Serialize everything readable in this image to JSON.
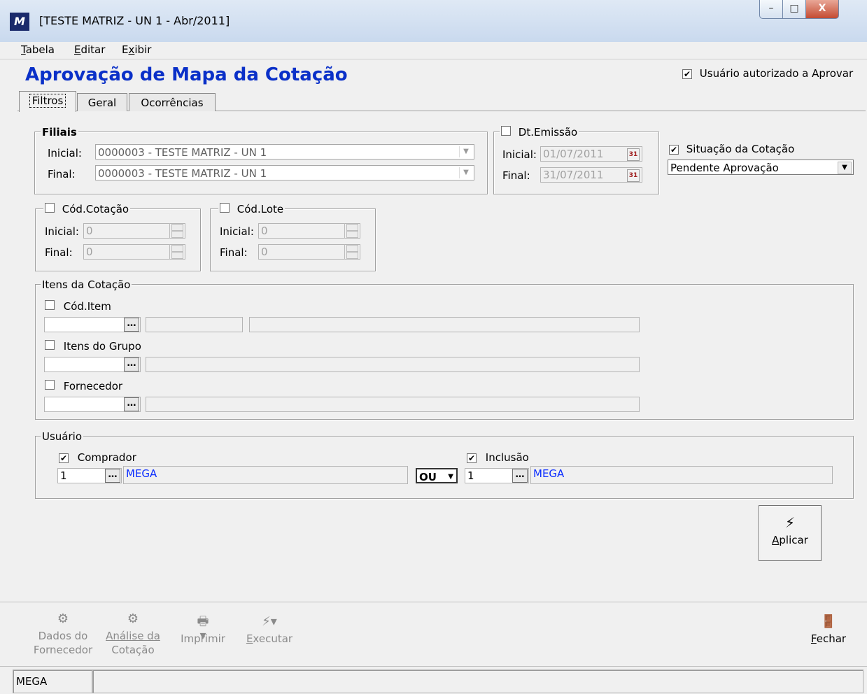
{
  "window": {
    "title": "[TESTE MATRIZ - UN 1 - Abr/2011]",
    "min": "–",
    "max": "□",
    "close": "X"
  },
  "menu": [
    {
      "label_first": "T",
      "label_rest": "abela"
    },
    {
      "label_first": "E",
      "label_rest": "ditar"
    },
    {
      "label_pre": "E",
      "label_u": "x",
      "label_rest": "ibir"
    }
  ],
  "page": {
    "title": "Aprovação de Mapa da Cotação",
    "authorized_label": "Usuário autorizado a Aprovar",
    "authorized_checked": "✔"
  },
  "tabs": {
    "filtros": "Filtros",
    "geral": "Geral",
    "ocorrencias": "Ocorrências"
  },
  "filiais": {
    "label": "Filiais",
    "initial_label": "Inicial:",
    "initial_value": "0000003 - TESTE MATRIZ - UN 1",
    "final_label": "Final:",
    "final_value": "0000003 - TESTE MATRIZ - UN 1"
  },
  "dt_emissao": {
    "label": "Dt.Emissão",
    "initial_label": "Inicial:",
    "initial_value": "01/07/2011",
    "final_label": "Final:",
    "final_value": "31/07/2011"
  },
  "situacao": {
    "label": "Situação da Cotação",
    "checked": "✔",
    "value": "Pendente Aprovação"
  },
  "cod_cotacao": {
    "label": "Cód.Cotação",
    "initial_label": "Inicial:",
    "initial_value": "0",
    "final_label": "Final:",
    "final_value": "0"
  },
  "cod_lote": {
    "label": "Cód.Lote",
    "initial_label": "Inicial:",
    "initial_value": "0",
    "final_label": "Final:",
    "final_value": "0"
  },
  "itens": {
    "label": "Itens da Cotação",
    "cod_item": "Cód.Item",
    "itens_grupo": "Itens do Grupo",
    "fornecedor": "Fornecedor",
    "dots": "…"
  },
  "usuario": {
    "label": "Usuário",
    "comprador_label": "Comprador",
    "comprador_checked": "✔",
    "comprador_code": "1",
    "comprador_name": "MEGA",
    "operator": "OU",
    "inclusao_label": "Inclusão",
    "inclusao_checked": "✔",
    "inclusao_code": "1",
    "inclusao_name": "MEGA"
  },
  "aplicar": {
    "first": "A",
    "rest": "plicar"
  },
  "toolbar": {
    "dados_fornecedor_1": "Dados do",
    "dados_fornecedor_2": "Fornecedor",
    "analise_1": "Análise da",
    "analise_2": "Cotação",
    "imprimir": "Imprimir",
    "executar_first": "E",
    "executar_rest": "xecutar",
    "fechar_first": "F",
    "fechar_rest": "echar"
  },
  "status": {
    "user": "MEGA"
  }
}
